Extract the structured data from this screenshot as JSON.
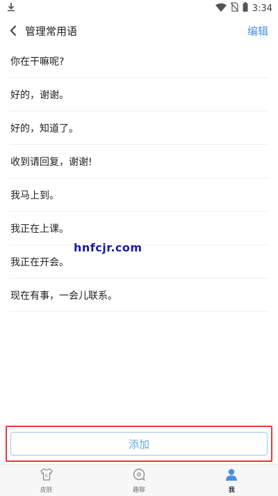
{
  "status_bar": {
    "time": "3:34"
  },
  "header": {
    "title": "管理常用语",
    "edit_label": "编辑"
  },
  "phrases": [
    "你在干嘛呢?",
    "好的，谢谢。",
    "好的，知道了。",
    "收到请回复，谢谢!",
    "我马上到。",
    "我正在上课。",
    "我正在开会。",
    "现在有事，一会儿联系。"
  ],
  "watermark": "hnfcjr.com",
  "add_button_label": "添加",
  "tabs": [
    {
      "label": "皮肤",
      "icon": "shirt-icon",
      "active": false
    },
    {
      "label": "趣聊",
      "icon": "chat-bubble-icon",
      "active": false
    },
    {
      "label": "我",
      "icon": "user-icon",
      "active": true
    }
  ],
  "colors": {
    "accent": "#4a90e2",
    "highlight_border": "#e53935"
  }
}
